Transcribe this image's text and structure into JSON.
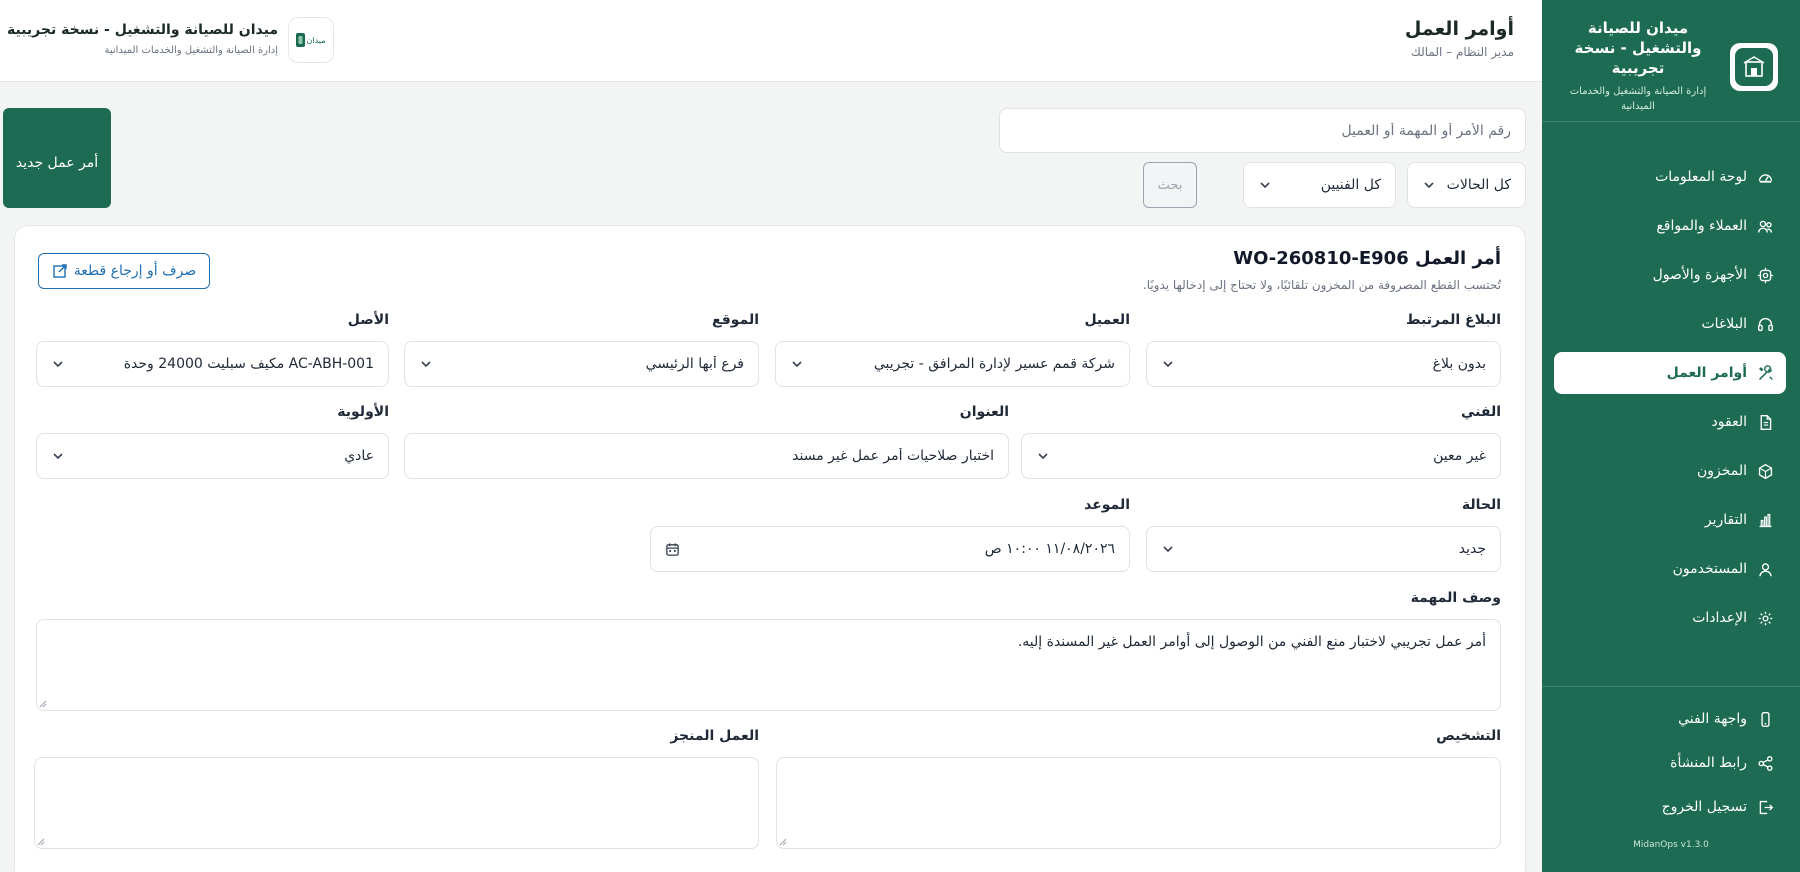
{
  "sidebar": {
    "brand_title": "ميدان للصيانة والتشغيل - نسخة تجريبية",
    "brand_subtitle": "إدارة الصيانة والتشغيل والخدمات الميدانية",
    "items": [
      {
        "label": "لوحة المعلومات",
        "icon": "gauge-icon"
      },
      {
        "label": "العملاء والمواقع",
        "icon": "users-icon"
      },
      {
        "label": "الأجهزة والأصول",
        "icon": "device-icon"
      },
      {
        "label": "البلاغات",
        "icon": "headset-icon"
      },
      {
        "label": "أوامر العمل",
        "icon": "tools-icon",
        "active": true
      },
      {
        "label": "العقود",
        "icon": "document-icon"
      },
      {
        "label": "المخزون",
        "icon": "box-icon"
      },
      {
        "label": "التقارير",
        "icon": "bar-chart-icon"
      },
      {
        "label": "المستخدمون",
        "icon": "user-icon"
      },
      {
        "label": "الإعدادات",
        "icon": "gear-icon"
      }
    ],
    "bottom_items": [
      {
        "label": "واجهة الفني",
        "icon": "phone-icon"
      },
      {
        "label": "رابط المنشأة",
        "icon": "share-icon"
      },
      {
        "label": "تسجيل الخروج",
        "icon": "logout-icon"
      }
    ],
    "version": "MidanOps v1.3.0"
  },
  "header": {
    "title": "أوامر العمل",
    "role": "مدير النظام – المالك",
    "org_title": "ميدان للصيانة والتشغيل - نسخة تجريبية",
    "org_subtitle": "إدارة الصيانة والتشغيل والخدمات الميدانية",
    "org_logo_text": "ميدان"
  },
  "toolbar": {
    "new_button": "أمر عمل جديد",
    "search_placeholder": "رقم الأمر أو المهمة أو العميل",
    "status_filter": "كل الحالات",
    "tech_filter": "كل الفنيين",
    "search_button": "بحث"
  },
  "work_order": {
    "title": "أمر العمل WO-260810-E906",
    "note": "تُحتسب القطع المصروفة من المخزون تلقائيًا، ولا تحتاج إلى إدخالها يدويًا.",
    "parts_button": "صرف أو إرجاع قطعة",
    "fields": {
      "linked_report": {
        "label": "البلاغ المرتبط",
        "value": "بدون بلاغ"
      },
      "client": {
        "label": "العميل",
        "value": "شركة قمم عسير لإدارة المرافق - تجريبي"
      },
      "site": {
        "label": "الموقع",
        "value": "فرع أبها الرئيسي"
      },
      "asset": {
        "label": "الأصل",
        "value": "AC-ABH-001 مكيف سبليت 24000 وحدة"
      },
      "technician": {
        "label": "الفني",
        "value": "غير معين"
      },
      "subject": {
        "label": "العنوان",
        "value": "اختبار صلاحيات أمر عمل غير مسند"
      },
      "priority": {
        "label": "الأولوية",
        "value": "عادي"
      },
      "status": {
        "label": "الحالة",
        "value": "جديد"
      },
      "appointment": {
        "label": "الموعد",
        "value": "١١/٠٨/٢٠٢٦ ١٠:٠٠ ص"
      },
      "description": {
        "label": "وصف المهمة",
        "value": "أمر عمل تجريبي لاختبار منع الفني من الوصول إلى أوامر العمل غير المسندة إليه."
      },
      "diagnosis": {
        "label": "التشخيص",
        "value": ""
      },
      "work_done": {
        "label": "العمل المنجز",
        "value": ""
      }
    }
  },
  "colors": {
    "primary": "#1c6b52",
    "link": "#1f6fb2",
    "background": "#f3f5f4"
  }
}
